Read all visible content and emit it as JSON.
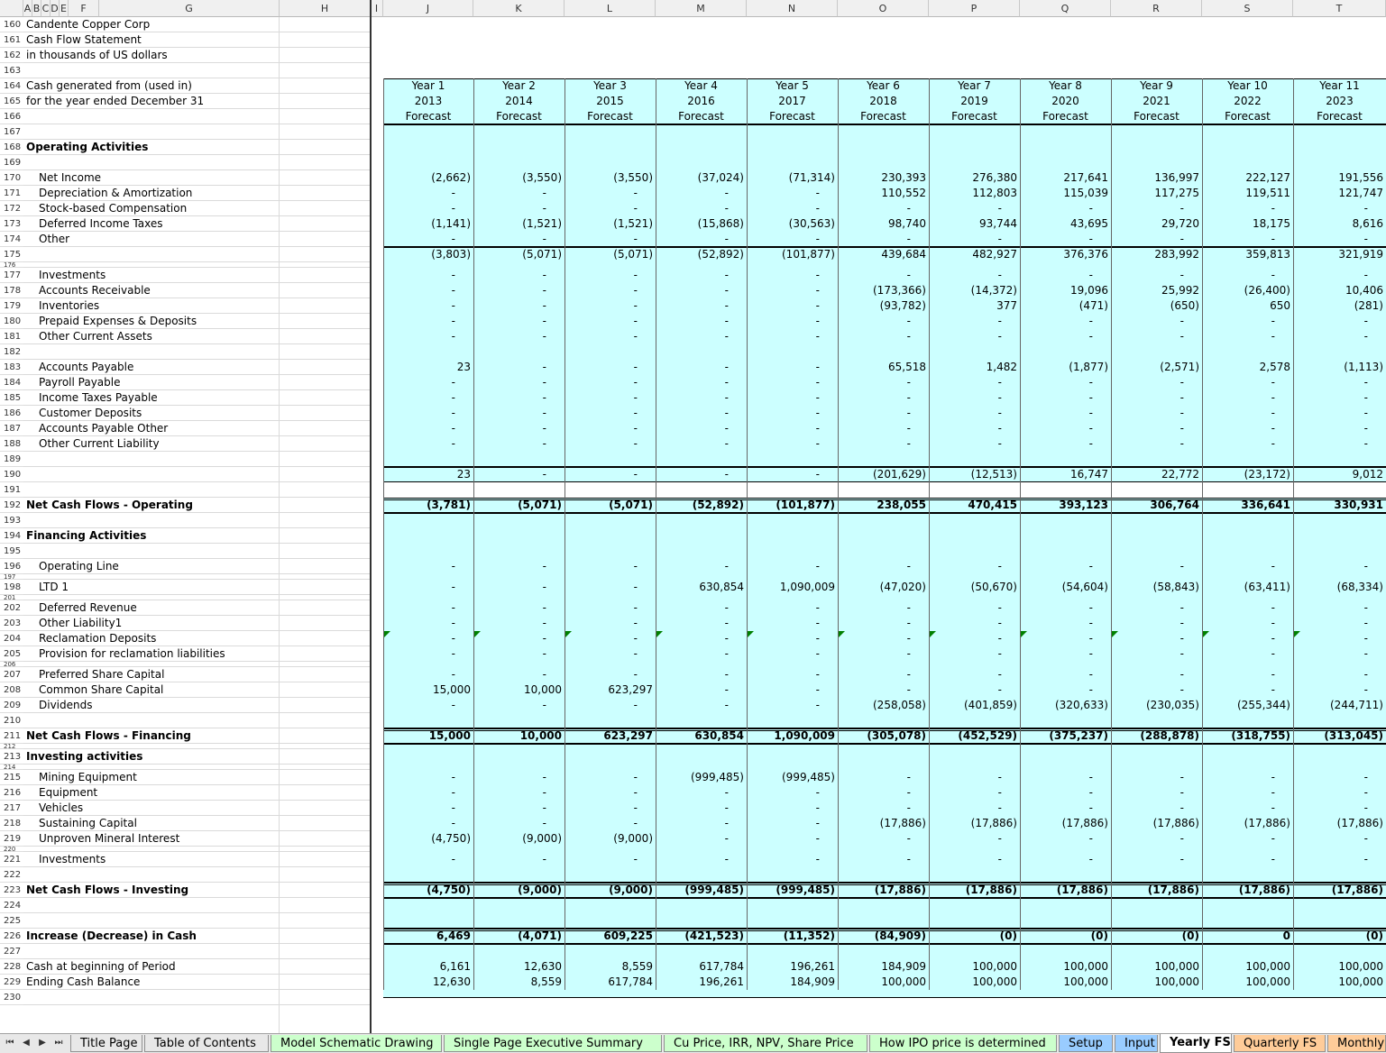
{
  "header": {
    "row_label_columns": [
      "A",
      "B",
      "C",
      "D",
      "E",
      "F",
      "G",
      "H",
      "I"
    ],
    "year_columns": [
      "J",
      "K",
      "L",
      "M",
      "N",
      "O",
      "P",
      "Q",
      "R",
      "S",
      "T"
    ]
  },
  "years": {
    "labels": [
      "Year 1",
      "Year 2",
      "Year 3",
      "Year 4",
      "Year 5",
      "Year 6",
      "Year 7",
      "Year 8",
      "Year 9",
      "Year 10",
      "Year 11"
    ],
    "calendar": [
      "2013",
      "2014",
      "2015",
      "2016",
      "2017",
      "2018",
      "2019",
      "2020",
      "2021",
      "2022",
      "2023"
    ],
    "status": [
      "Forecast",
      "Forecast",
      "Forecast",
      "Forecast",
      "Forecast",
      "Forecast",
      "Forecast",
      "Forecast",
      "Forecast",
      "Forecast",
      "Forecast"
    ]
  },
  "rows": [
    {
      "n": "160",
      "label": "Candente Copper Corp",
      "indent": 0,
      "bold": false,
      "values": null
    },
    {
      "n": "161",
      "label": "Cash Flow Statement",
      "indent": 0,
      "bold": false,
      "values": null
    },
    {
      "n": "162",
      "label": "in thousands of US dollars",
      "indent": 0,
      "bold": false,
      "values": null
    },
    {
      "n": "163",
      "label": "",
      "indent": 0,
      "bold": false,
      "values": null
    },
    {
      "n": "164",
      "label": "Cash generated from (used in)",
      "indent": 0,
      "bold": false,
      "values": null,
      "hdr": "labels"
    },
    {
      "n": "165",
      "label": "for the year ended December 31",
      "indent": 0,
      "bold": false,
      "values": null,
      "hdr": "calendar"
    },
    {
      "n": "166",
      "label": "",
      "indent": 0,
      "bold": false,
      "values": null,
      "hdr": "status"
    },
    {
      "n": "167",
      "label": "",
      "indent": 0,
      "bold": false,
      "values": null
    },
    {
      "n": "168",
      "label": "Operating Activities",
      "indent": 0,
      "bold": true,
      "values": null
    },
    {
      "n": "169",
      "label": "",
      "indent": 0,
      "bold": false,
      "values": null
    },
    {
      "n": "170",
      "label": "Net Income",
      "indent": 1,
      "bold": false,
      "values": [
        "(2,662)",
        "(3,550)",
        "(3,550)",
        "(37,024)",
        "(71,314)",
        "230,393",
        "276,380",
        "217,641",
        "136,997",
        "222,127",
        "191,556"
      ]
    },
    {
      "n": "171",
      "label": "Depreciation & Amortization",
      "indent": 1,
      "bold": false,
      "values": [
        "-",
        "-",
        "-",
        "-",
        "-",
        "110,552",
        "112,803",
        "115,039",
        "117,275",
        "119,511",
        "121,747"
      ]
    },
    {
      "n": "172",
      "label": "Stock-based Compensation",
      "indent": 1,
      "bold": false,
      "values": [
        "-",
        "-",
        "-",
        "-",
        "-",
        "-",
        "-",
        "-",
        "-",
        "-",
        "-"
      ]
    },
    {
      "n": "173",
      "label": "Deferred Income Taxes",
      "indent": 1,
      "bold": false,
      "values": [
        "(1,141)",
        "(1,521)",
        "(1,521)",
        "(15,868)",
        "(30,563)",
        "98,740",
        "93,744",
        "43,695",
        "29,720",
        "18,175",
        "8,616"
      ]
    },
    {
      "n": "174",
      "label": "Other",
      "indent": 1,
      "bold": false,
      "values": [
        "-",
        "-",
        "-",
        "-",
        "-",
        "-",
        "-",
        "-",
        "-",
        "-",
        "-"
      ]
    },
    {
      "n": "175",
      "label": "",
      "indent": 1,
      "bold": false,
      "values": [
        "(3,803)",
        "(5,071)",
        "(5,071)",
        "(52,892)",
        "(101,877)",
        "439,684",
        "482,927",
        "376,376",
        "283,992",
        "359,813",
        "321,919"
      ]
    },
    {
      "n": "176",
      "label": "",
      "indent": 0,
      "bold": false,
      "values": null,
      "small": true
    },
    {
      "n": "177",
      "label": "Investments",
      "indent": 1,
      "bold": false,
      "values": [
        "-",
        "-",
        "-",
        "-",
        "-",
        "-",
        "-",
        "-",
        "-",
        "-",
        "-"
      ]
    },
    {
      "n": "178",
      "label": "Accounts Receivable",
      "indent": 1,
      "bold": false,
      "values": [
        "-",
        "-",
        "-",
        "-",
        "-",
        "(173,366)",
        "(14,372)",
        "19,096",
        "25,992",
        "(26,400)",
        "10,406"
      ]
    },
    {
      "n": "179",
      "label": "Inventories",
      "indent": 1,
      "bold": false,
      "values": [
        "-",
        "-",
        "-",
        "-",
        "-",
        "(93,782)",
        "377",
        "(471)",
        "(650)",
        "650",
        "(281)"
      ]
    },
    {
      "n": "180",
      "label": "Prepaid Expenses & Deposits",
      "indent": 1,
      "bold": false,
      "values": [
        "-",
        "-",
        "-",
        "-",
        "-",
        "-",
        "-",
        "-",
        "-",
        "-",
        "-"
      ]
    },
    {
      "n": "181",
      "label": "Other Current Assets",
      "indent": 1,
      "bold": false,
      "values": [
        "-",
        "-",
        "-",
        "-",
        "-",
        "-",
        "-",
        "-",
        "-",
        "-",
        "-"
      ]
    },
    {
      "n": "182",
      "label": "",
      "indent": 0,
      "bold": false,
      "values": null
    },
    {
      "n": "183",
      "label": "Accounts Payable",
      "indent": 1,
      "bold": false,
      "values": [
        "23",
        "-",
        "-",
        "-",
        "-",
        "65,518",
        "1,482",
        "(1,877)",
        "(2,571)",
        "2,578",
        "(1,113)"
      ]
    },
    {
      "n": "184",
      "label": "Payroll Payable",
      "indent": 1,
      "bold": false,
      "values": [
        "-",
        "-",
        "-",
        "-",
        "-",
        "-",
        "-",
        "-",
        "-",
        "-",
        "-"
      ]
    },
    {
      "n": "185",
      "label": "Income Taxes Payable",
      "indent": 1,
      "bold": false,
      "values": [
        "-",
        "-",
        "-",
        "-",
        "-",
        "-",
        "-",
        "-",
        "-",
        "-",
        "-"
      ]
    },
    {
      "n": "186",
      "label": "Customer Deposits",
      "indent": 1,
      "bold": false,
      "values": [
        "-",
        "-",
        "-",
        "-",
        "-",
        "-",
        "-",
        "-",
        "-",
        "-",
        "-"
      ]
    },
    {
      "n": "187",
      "label": "Accounts Payable Other",
      "indent": 1,
      "bold": false,
      "values": [
        "-",
        "-",
        "-",
        "-",
        "-",
        "-",
        "-",
        "-",
        "-",
        "-",
        "-"
      ]
    },
    {
      "n": "188",
      "label": "Other Current Liability",
      "indent": 1,
      "bold": false,
      "values": [
        "-",
        "-",
        "-",
        "-",
        "-",
        "-",
        "-",
        "-",
        "-",
        "-",
        "-"
      ]
    },
    {
      "n": "189",
      "label": "",
      "indent": 0,
      "bold": false,
      "values": null
    },
    {
      "n": "190",
      "label": "",
      "indent": 0,
      "bold": false,
      "values": [
        "23",
        "-",
        "-",
        "-",
        "-",
        "(201,629)",
        "(12,513)",
        "16,747",
        "22,772",
        "(23,172)",
        "9,012"
      ]
    },
    {
      "n": "191",
      "label": "",
      "indent": 0,
      "bold": false,
      "values": null
    },
    {
      "n": "192",
      "label": "Net Cash Flows - Operating",
      "indent": 0,
      "bold": true,
      "values": [
        "(3,781)",
        "(5,071)",
        "(5,071)",
        "(52,892)",
        "(101,877)",
        "238,055",
        "470,415",
        "393,123",
        "306,764",
        "336,641",
        "330,931"
      ]
    },
    {
      "n": "193",
      "label": "",
      "indent": 0,
      "bold": false,
      "values": null
    },
    {
      "n": "194",
      "label": "Financing Activities",
      "indent": 0,
      "bold": true,
      "values": null
    },
    {
      "n": "195",
      "label": "",
      "indent": 0,
      "bold": false,
      "values": null
    },
    {
      "n": "196",
      "label": "Operating Line",
      "indent": 1,
      "bold": false,
      "values": [
        "-",
        "-",
        "-",
        "-",
        "-",
        "-",
        "-",
        "-",
        "-",
        "-",
        "-"
      ]
    },
    {
      "n": "197",
      "label": "",
      "indent": 0,
      "bold": false,
      "values": null,
      "small": true
    },
    {
      "n": "198",
      "label": "LTD 1",
      "indent": 1,
      "bold": false,
      "values": [
        "-",
        "-",
        "-",
        "630,854",
        "1,090,009",
        "(47,020)",
        "(50,670)",
        "(54,604)",
        "(58,843)",
        "(63,411)",
        "(68,334)"
      ]
    },
    {
      "n": "201",
      "label": "",
      "indent": 0,
      "bold": false,
      "values": null,
      "small": true
    },
    {
      "n": "202",
      "label": "Deferred Revenue",
      "indent": 1,
      "bold": false,
      "values": [
        "-",
        "-",
        "-",
        "-",
        "-",
        "-",
        "-",
        "-",
        "-",
        "-",
        "-"
      ]
    },
    {
      "n": "203",
      "label": "Other Liability1",
      "indent": 1,
      "bold": false,
      "values": [
        "-",
        "-",
        "-",
        "-",
        "-",
        "-",
        "-",
        "-",
        "-",
        "-",
        "-"
      ]
    },
    {
      "n": "204",
      "label": "Reclamation Deposits",
      "indent": 1,
      "bold": false,
      "values": [
        "-",
        "-",
        "-",
        "-",
        "-",
        "-",
        "-",
        "-",
        "-",
        "-",
        "-"
      ]
    },
    {
      "n": "205",
      "label": "Provision for reclamation liabilities",
      "indent": 1,
      "bold": false,
      "values": [
        "-",
        "-",
        "-",
        "-",
        "-",
        "-",
        "-",
        "-",
        "-",
        "-",
        "-"
      ]
    },
    {
      "n": "206",
      "label": "",
      "indent": 0,
      "bold": false,
      "values": null,
      "small": true
    },
    {
      "n": "207",
      "label": "Preferred Share Capital",
      "indent": 1,
      "bold": false,
      "values": [
        "-",
        "-",
        "-",
        "-",
        "-",
        "-",
        "-",
        "-",
        "-",
        "-",
        "-"
      ]
    },
    {
      "n": "208",
      "label": "Common Share Capital",
      "indent": 1,
      "bold": false,
      "values": [
        "15,000",
        "10,000",
        "623,297",
        "-",
        "-",
        "-",
        "-",
        "-",
        "-",
        "-",
        "-"
      ]
    },
    {
      "n": "209",
      "label": "Dividends",
      "indent": 1,
      "bold": false,
      "values": [
        "-",
        "-",
        "-",
        "-",
        "-",
        "(258,058)",
        "(401,859)",
        "(320,633)",
        "(230,035)",
        "(255,344)",
        "(244,711)"
      ]
    },
    {
      "n": "210",
      "label": "",
      "indent": 0,
      "bold": false,
      "values": null
    },
    {
      "n": "211",
      "label": "Net Cash Flows - Financing",
      "indent": 0,
      "bold": true,
      "values": [
        "15,000",
        "10,000",
        "623,297",
        "630,854",
        "1,090,009",
        "(305,078)",
        "(452,529)",
        "(375,237)",
        "(288,878)",
        "(318,755)",
        "(313,045)"
      ]
    },
    {
      "n": "212",
      "label": "",
      "indent": 0,
      "bold": false,
      "values": null,
      "small": true
    },
    {
      "n": "213",
      "label": "Investing activities",
      "indent": 0,
      "bold": true,
      "values": null
    },
    {
      "n": "214",
      "label": "",
      "indent": 0,
      "bold": false,
      "values": null,
      "small": true
    },
    {
      "n": "215",
      "label": "Mining Equipment",
      "indent": 1,
      "bold": false,
      "values": [
        "-",
        "-",
        "-",
        "(999,485)",
        "(999,485)",
        "-",
        "-",
        "-",
        "-",
        "-",
        "-"
      ]
    },
    {
      "n": "216",
      "label": "Equipment",
      "indent": 1,
      "bold": false,
      "values": [
        "-",
        "-",
        "-",
        "-",
        "-",
        "-",
        "-",
        "-",
        "-",
        "-",
        "-"
      ]
    },
    {
      "n": "217",
      "label": "Vehicles",
      "indent": 1,
      "bold": false,
      "values": [
        "-",
        "-",
        "-",
        "-",
        "-",
        "-",
        "-",
        "-",
        "-",
        "-",
        "-"
      ]
    },
    {
      "n": "218",
      "label": "Sustaining Capital",
      "indent": 1,
      "bold": false,
      "values": [
        "-",
        "-",
        "-",
        "-",
        "-",
        "(17,886)",
        "(17,886)",
        "(17,886)",
        "(17,886)",
        "(17,886)",
        "(17,886)"
      ]
    },
    {
      "n": "219",
      "label": "Unproven Mineral Interest",
      "indent": 1,
      "bold": false,
      "values": [
        "(4,750)",
        "(9,000)",
        "(9,000)",
        "-",
        "-",
        "-",
        "-",
        "-",
        "-",
        "-",
        "-"
      ]
    },
    {
      "n": "220",
      "label": "",
      "indent": 0,
      "bold": false,
      "values": null,
      "small": true
    },
    {
      "n": "221",
      "label": "Investments",
      "indent": 1,
      "bold": false,
      "values": [
        "-",
        "-",
        "-",
        "-",
        "-",
        "-",
        "-",
        "-",
        "-",
        "-",
        "-"
      ]
    },
    {
      "n": "222",
      "label": "",
      "indent": 0,
      "bold": false,
      "values": null
    },
    {
      "n": "223",
      "label": "Net Cash Flows - Investing",
      "indent": 0,
      "bold": true,
      "values": [
        "(4,750)",
        "(9,000)",
        "(9,000)",
        "(999,485)",
        "(999,485)",
        "(17,886)",
        "(17,886)",
        "(17,886)",
        "(17,886)",
        "(17,886)",
        "(17,886)"
      ]
    },
    {
      "n": "224",
      "label": "",
      "indent": 0,
      "bold": false,
      "values": null
    },
    {
      "n": "225",
      "label": "",
      "indent": 0,
      "bold": false,
      "values": null
    },
    {
      "n": "226",
      "label": "Increase (Decrease) in Cash",
      "indent": 0,
      "bold": true,
      "values": [
        "6,469",
        "(4,071)",
        "609,225",
        "(421,523)",
        "(11,352)",
        "(84,909)",
        "(0)",
        "(0)",
        "(0)",
        "0",
        "(0)"
      ]
    },
    {
      "n": "227",
      "label": "",
      "indent": 0,
      "bold": false,
      "values": null
    },
    {
      "n": "228",
      "label": "Cash at beginning of Period",
      "indent": 0,
      "bold": false,
      "values": [
        "6,161",
        "12,630",
        "8,559",
        "617,784",
        "196,261",
        "184,909",
        "100,000",
        "100,000",
        "100,000",
        "100,000",
        "100,000"
      ]
    },
    {
      "n": "229",
      "label": "Ending Cash Balance",
      "indent": 0,
      "bold": false,
      "values": [
        "12,630",
        "8,559",
        "617,784",
        "196,261",
        "184,909",
        "100,000",
        "100,000",
        "100,000",
        "100,000",
        "100,000",
        "100,000"
      ]
    },
    {
      "n": "230",
      "label": "",
      "indent": 0,
      "bold": false,
      "values": null
    }
  ],
  "tabs": [
    {
      "label": "Title Page",
      "color": "#e8e8e8",
      "active": false
    },
    {
      "label": "Table of Contents",
      "color": "#e8e8e8",
      "active": false
    },
    {
      "label": "Model Schematic Drawing",
      "color": "#ccffcc",
      "active": false
    },
    {
      "label": "Single Page  Executive Summary",
      "color": "#ccffcc",
      "active": false
    },
    {
      "label": "Cu Price, IRR, NPV, Share Price",
      "color": "#ccffcc",
      "active": false
    },
    {
      "label": "How IPO price is determined",
      "color": "#ccffcc",
      "active": false
    },
    {
      "label": "Setup",
      "color": "#99ccff",
      "active": false
    },
    {
      "label": "Input",
      "color": "#99ccff",
      "active": false
    },
    {
      "label": "Yearly FS",
      "color": "#ffffff",
      "active": true
    },
    {
      "label": "Quarterly FS",
      "color": "#ffcc99",
      "active": false
    },
    {
      "label": "Monthly",
      "color": "#ffcc99",
      "active": false
    }
  ],
  "colors": {
    "block": "#ccffff",
    "gridline": "#dadada",
    "accent_flag": "#008000"
  }
}
